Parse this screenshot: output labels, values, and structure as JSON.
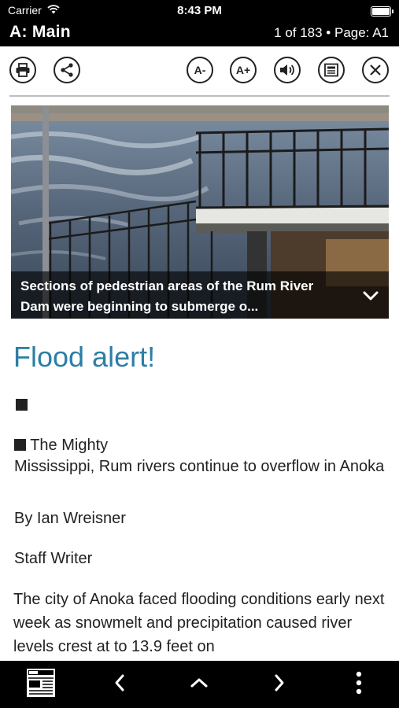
{
  "status": {
    "carrier": "Carrier",
    "time": "8:43 PM",
    "battery_level": 1.0
  },
  "header": {
    "section": "A: Main",
    "page_info": "1 of 183 • Page: A1"
  },
  "toolbar": {
    "print_icon": "printer-icon",
    "share_icon": "share-icon",
    "font_smaller_label": "A-",
    "font_larger_label": "A+",
    "audio_icon": "speaker-icon",
    "page_view_icon": "newspaper-page-icon",
    "close_icon": "close-icon"
  },
  "photo": {
    "caption": "Sections of pedestrian areas of the Rum River Dam were beginning to submerge o...",
    "expand_icon": "chevron-down-icon"
  },
  "article": {
    "headline": "Flood alert!",
    "deck_first": "The Mighty",
    "deck_rest": "Mississippi, Rum rivers continue to overflow in Anoka",
    "byline": "By Ian Wreisner",
    "role": "Staff Writer",
    "body": "The city of Anoka faced flooding conditions early next week as snowmelt and precipitation caused river levels crest at to 13.9 feet on"
  },
  "bottom_nav": {
    "sections_icon": "newspaper-icon",
    "prev_icon": "chevron-left-icon",
    "up_icon": "chevron-up-icon",
    "next_icon": "chevron-right-icon",
    "more_icon": "more-vertical-icon"
  },
  "colors": {
    "headline": "#2c7ea5",
    "bar": "#000000"
  }
}
